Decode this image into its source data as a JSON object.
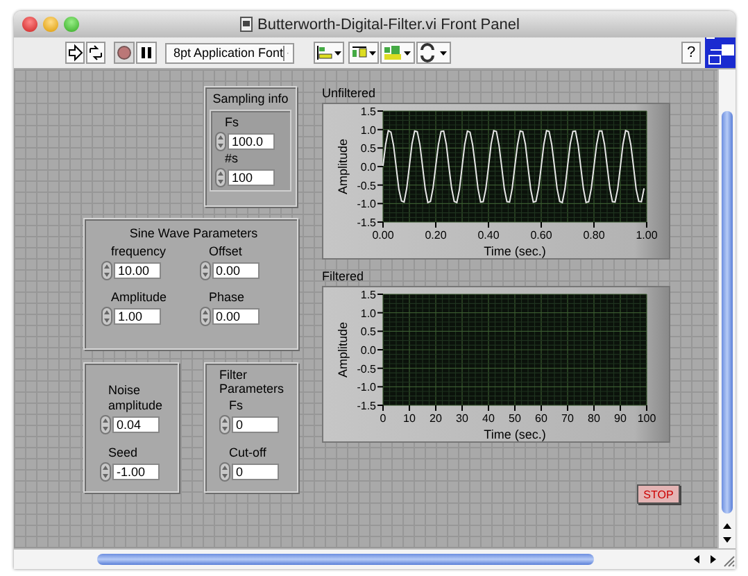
{
  "window": {
    "title": "Butterworth-Digital-Filter.vi Front Panel"
  },
  "toolbar": {
    "font": "8pt Application Font",
    "help": "?"
  },
  "groups": [
    {
      "kind": "inset",
      "title": "Sampling info",
      "controls": [
        {
          "label": "Fs",
          "value": "100.0"
        },
        {
          "label": "#s",
          "value": "100"
        }
      ]
    },
    {
      "kind": "grid",
      "title": "Sine Wave Parameters",
      "controls": [
        {
          "label": "frequency",
          "value": "10.00"
        },
        {
          "label": "Offset",
          "value": "0.00"
        },
        {
          "label": "Amplitude",
          "value": "1.00"
        },
        {
          "label": "Phase",
          "value": "0.00"
        }
      ]
    },
    {
      "kind": "stack",
      "controls": [
        {
          "label": "Noise amplitude",
          "value": "0.04"
        },
        {
          "label": "Seed",
          "value": "-1.00"
        }
      ]
    },
    {
      "kind": "stack",
      "title": "Filter Parameters",
      "controls": [
        {
          "label": "Fs",
          "value": "0"
        },
        {
          "label": "Cut-off",
          "value": "0"
        }
      ]
    }
  ],
  "graphs": [
    {
      "label": "Unfiltered",
      "chart_data": {
        "type": "line",
        "grid": true,
        "xlabel": "Time (sec.)",
        "ylabel": "Amplitude",
        "xlim": [
          0,
          1
        ],
        "ylim": [
          -1.5,
          1.5
        ],
        "xticks": [
          {
            "value": 0,
            "label": "0.00"
          },
          {
            "value": 0.2,
            "label": "0.20"
          },
          {
            "value": 0.4,
            "label": "0.40"
          },
          {
            "value": 0.6,
            "label": "0.60"
          },
          {
            "value": 0.8,
            "label": "0.80"
          },
          {
            "value": 1,
            "label": "1.00"
          }
        ],
        "yticks": [
          {
            "value": 1.5,
            "label": "1.5"
          },
          {
            "value": 1,
            "label": "1.0"
          },
          {
            "value": 0.5,
            "label": "0.5"
          },
          {
            "value": 0,
            "label": "0.0"
          },
          {
            "value": -0.5,
            "label": "-0.5"
          },
          {
            "value": -1,
            "label": "-1.0"
          },
          {
            "value": -1.5,
            "label": "-1.5"
          }
        ],
        "x": [
          0,
          0.01,
          0.02,
          0.03,
          0.04,
          0.05,
          0.06,
          0.07,
          0.08,
          0.09,
          0.1,
          0.11,
          0.12,
          0.13,
          0.14,
          0.15,
          0.16,
          0.17,
          0.18,
          0.19,
          0.2,
          0.21,
          0.22,
          0.23,
          0.24,
          0.25,
          0.26,
          0.27,
          0.28,
          0.29,
          0.3,
          0.31,
          0.32,
          0.33,
          0.34,
          0.35,
          0.36,
          0.37,
          0.38,
          0.39,
          0.4,
          0.41,
          0.42,
          0.43,
          0.44,
          0.45,
          0.46,
          0.47,
          0.48,
          0.49,
          0.5,
          0.51,
          0.52,
          0.53,
          0.54,
          0.55,
          0.56,
          0.57,
          0.58,
          0.59,
          0.6,
          0.61,
          0.62,
          0.63,
          0.64,
          0.65,
          0.66,
          0.67,
          0.68,
          0.69,
          0.7,
          0.71,
          0.72,
          0.73,
          0.74,
          0.75,
          0.76,
          0.77,
          0.78,
          0.79,
          0.8,
          0.81,
          0.82,
          0.83,
          0.84,
          0.85,
          0.86,
          0.87,
          0.88,
          0.89,
          0.9,
          0.91,
          0.92,
          0.93,
          0.94,
          0.95,
          0.96,
          0.97,
          0.98,
          0.99
        ],
        "series": [
          {
            "color": "#e8e8e8",
            "values": [
              0.02,
              0.6,
              0.97,
              0.93,
              0.57,
              -0.02,
              -0.61,
              -0.93,
              -0.96,
              -0.58,
              0.01,
              0.62,
              0.96,
              0.94,
              0.59,
              0.0,
              -0.6,
              -0.97,
              -0.94,
              -0.57,
              0.02,
              0.59,
              0.95,
              0.96,
              0.6,
              -0.01,
              -0.58,
              -0.94,
              -0.97,
              -0.61,
              0.0,
              0.6,
              0.96,
              0.93,
              0.58,
              0.02,
              -0.59,
              -0.96,
              -0.95,
              -0.6,
              -0.01,
              0.61,
              0.97,
              0.95,
              0.57,
              0.0,
              -0.6,
              -0.95,
              -0.96,
              -0.59,
              0.01,
              0.58,
              0.96,
              0.94,
              0.6,
              -0.02,
              -0.61,
              -0.96,
              -0.94,
              -0.58,
              0.0,
              0.6,
              0.97,
              0.95,
              0.59,
              0.01,
              -0.59,
              -0.94,
              -0.97,
              -0.6,
              0.02,
              0.61,
              0.95,
              0.96,
              0.58,
              -0.01,
              -0.6,
              -0.97,
              -0.95,
              -0.59,
              0.0,
              0.59,
              0.96,
              0.96,
              0.6,
              0.01,
              -0.58,
              -0.95,
              -0.96,
              -0.61,
              -0.02,
              0.6,
              0.97,
              0.94,
              0.58,
              0.0,
              -0.61,
              -0.94,
              -0.95,
              -0.59
            ]
          }
        ]
      }
    },
    {
      "label": "Filtered",
      "chart_data": {
        "type": "line",
        "grid": true,
        "xlabel": "Time (sec.)",
        "ylabel": "Amplitude",
        "xlim": [
          0,
          100
        ],
        "ylim": [
          -1.5,
          1.5
        ],
        "xticks": [
          0,
          10,
          20,
          30,
          40,
          50,
          60,
          70,
          80,
          90,
          100
        ],
        "yticks": [
          {
            "value": 1.5,
            "label": "1.5"
          },
          {
            "value": 1,
            "label": "1.0"
          },
          {
            "value": 0.5,
            "label": "0.5"
          },
          {
            "value": 0,
            "label": "0.0"
          },
          {
            "value": -0.5,
            "label": "-0.5"
          },
          {
            "value": -1,
            "label": "-1.0"
          },
          {
            "value": -1.5,
            "label": "-1.5"
          }
        ]
      }
    }
  ],
  "stop_button": {
    "label": "STOP"
  }
}
